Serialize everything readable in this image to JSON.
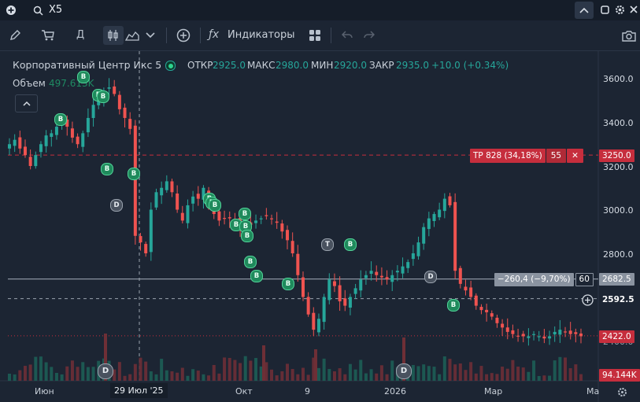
{
  "search": {
    "value": "X5"
  },
  "toolbar": {
    "timeframe": "Д",
    "indicators_label": "Индикаторы"
  },
  "legend": {
    "title": "Корпоративный Центр Икс 5",
    "open_label": "ОТКР",
    "open": "2925.0",
    "high_label": "МАКС",
    "high": "2980.0",
    "low_label": "МИН",
    "low": "2920.0",
    "close_label": "ЗАКР",
    "close": "2935.0",
    "change": "+10.0 (+0.34%)",
    "volume_label": "Объем",
    "volume": "497.613K"
  },
  "y_axis": {
    "ticks": [
      "3600.0",
      "3400.0",
      "3200.0",
      "3000.0",
      "2800.0",
      "2400.0"
    ],
    "tp_price": "3250.0",
    "line_price": "2682.5",
    "cursor_price": "2592.5",
    "last_price": "2422.0",
    "volume_label": "94.144K"
  },
  "x_axis": {
    "labels": [
      "Июн",
      "Окт",
      "9",
      "2026",
      "Мар",
      "Ма"
    ],
    "cursor_date": "29 Июл '25"
  },
  "order_tp": {
    "label": "TP 828 (34,18%)",
    "qty": "55",
    "close": "✕"
  },
  "position_line": {
    "label": "−260,4 (−9,70%)",
    "qty": "60"
  },
  "markers": {
    "b": "B",
    "d": "D",
    "t": "T"
  },
  "colors": {
    "up": "#26a69a",
    "down": "#ef5350",
    "bg": "#1c2533",
    "tp": "#c62e3d",
    "line": "#8a93a0"
  },
  "chart_data": {
    "type": "candlestick",
    "title": "Корпоративный Центр Икс 5",
    "ohlc_last": {
      "open": 2925.0,
      "high": 2980.0,
      "low": 2920.0,
      "close": 2935.0
    },
    "ylim": [
      2350,
      3700
    ],
    "y_ticks": [
      3600,
      3400,
      3200,
      3000,
      2800,
      2400
    ],
    "x_ticks": [
      "Июн",
      "Окт",
      "9",
      "2026",
      "Мар",
      "Ма"
    ],
    "series": [
      {
        "name": "close_approx",
        "values": [
          3300,
          3320,
          3280,
          3250,
          3200,
          3250,
          3300,
          3340,
          3350,
          3380,
          3400,
          3380,
          3330,
          3300,
          3350,
          3420,
          3480,
          3520,
          3540,
          3560,
          3530,
          3460,
          3420,
          3370,
          2880,
          2850,
          2800,
          3000,
          3080,
          3100,
          3130,
          3080,
          3000,
          2950,
          3020,
          3060,
          3050,
          3100,
          3020,
          2980,
          2950,
          2960,
          2960,
          2950,
          2920,
          2940,
          2930,
          2950,
          2960,
          2970,
          2960,
          2940,
          2900,
          2860,
          2800,
          2700,
          2600,
          2520,
          2450,
          2500,
          2600,
          2680,
          2650,
          2580,
          2560,
          2600,
          2640,
          2680,
          2700,
          2720,
          2700,
          2690,
          2680,
          2700,
          2720,
          2740,
          2760,
          2800,
          2850,
          2920,
          2960,
          2980,
          3000,
          3050,
          3020,
          2720,
          2660,
          2630,
          2600,
          2560,
          2540,
          2530,
          2510,
          2480,
          2460,
          2440,
          2430,
          2420,
          2420,
          2420,
          2430,
          2420,
          2410,
          2420,
          2440,
          2450,
          2440,
          2430,
          2430,
          2420
        ]
      }
    ]
  }
}
